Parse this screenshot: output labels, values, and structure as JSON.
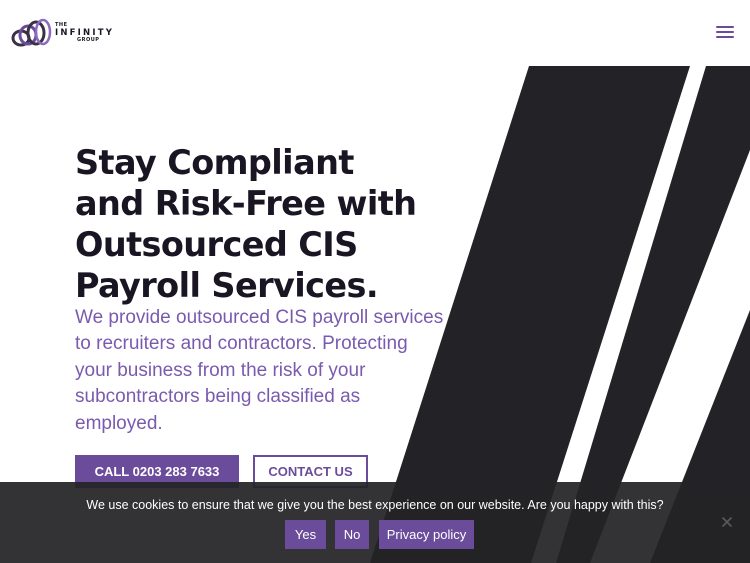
{
  "header": {
    "logo": {
      "line1": "THE",
      "line2": "INFINITY",
      "line3": "GROUP"
    },
    "menu_icon": "hamburger-menu-icon"
  },
  "hero": {
    "title_lines": [
      "Stay Compliant",
      "and Risk-Free with",
      "Outsourced CIS",
      "Payroll Services."
    ],
    "subtitle_lines": [
      "We provide outsourced CIS payroll services",
      "to recruiters and contractors. Protecting",
      "your business from the risk of your",
      "subcontractors being classified as",
      "employed."
    ],
    "call_button": "CALL 0203 283 7633",
    "contact_button": "CONTACT US"
  },
  "cookie": {
    "message": "We use cookies to ensure that we give you the best experience on our website. Are you happy with this?",
    "yes": "Yes",
    "no": "No",
    "privacy": "Privacy policy",
    "close_icon": "close-icon"
  },
  "colors": {
    "accent": "#6b4c9a",
    "accent_text": "#7a5aaf",
    "heading": "#1a1523",
    "stripes": "#232226",
    "cookie_bg": "#242426"
  }
}
